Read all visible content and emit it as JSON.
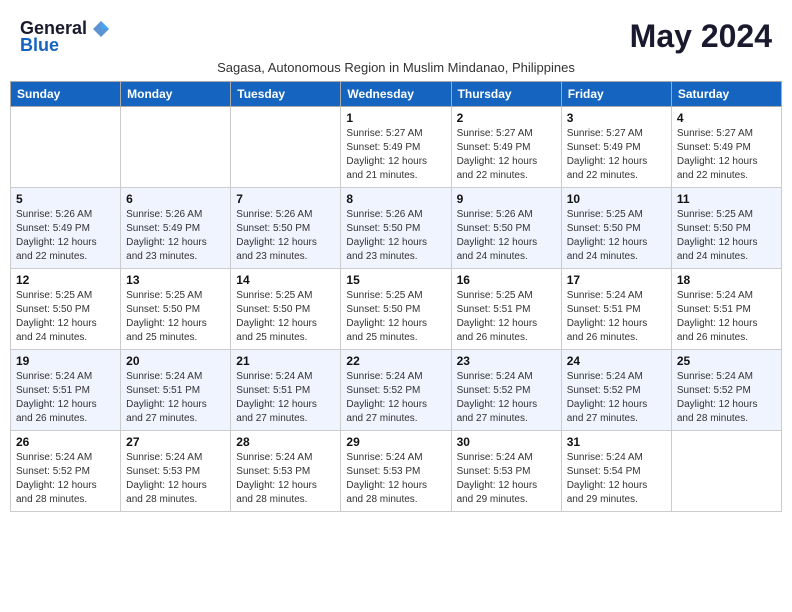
{
  "header": {
    "logo_general": "General",
    "logo_blue": "Blue",
    "month_title": "May 2024",
    "subtitle": "Sagasa, Autonomous Region in Muslim Mindanao, Philippines"
  },
  "weekdays": [
    "Sunday",
    "Monday",
    "Tuesday",
    "Wednesday",
    "Thursday",
    "Friday",
    "Saturday"
  ],
  "weeks": [
    [
      {
        "day": "",
        "info": ""
      },
      {
        "day": "",
        "info": ""
      },
      {
        "day": "",
        "info": ""
      },
      {
        "day": "1",
        "info": "Sunrise: 5:27 AM\nSunset: 5:49 PM\nDaylight: 12 hours\nand 21 minutes."
      },
      {
        "day": "2",
        "info": "Sunrise: 5:27 AM\nSunset: 5:49 PM\nDaylight: 12 hours\nand 22 minutes."
      },
      {
        "day": "3",
        "info": "Sunrise: 5:27 AM\nSunset: 5:49 PM\nDaylight: 12 hours\nand 22 minutes."
      },
      {
        "day": "4",
        "info": "Sunrise: 5:27 AM\nSunset: 5:49 PM\nDaylight: 12 hours\nand 22 minutes."
      }
    ],
    [
      {
        "day": "5",
        "info": "Sunrise: 5:26 AM\nSunset: 5:49 PM\nDaylight: 12 hours\nand 22 minutes."
      },
      {
        "day": "6",
        "info": "Sunrise: 5:26 AM\nSunset: 5:49 PM\nDaylight: 12 hours\nand 23 minutes."
      },
      {
        "day": "7",
        "info": "Sunrise: 5:26 AM\nSunset: 5:50 PM\nDaylight: 12 hours\nand 23 minutes."
      },
      {
        "day": "8",
        "info": "Sunrise: 5:26 AM\nSunset: 5:50 PM\nDaylight: 12 hours\nand 23 minutes."
      },
      {
        "day": "9",
        "info": "Sunrise: 5:26 AM\nSunset: 5:50 PM\nDaylight: 12 hours\nand 24 minutes."
      },
      {
        "day": "10",
        "info": "Sunrise: 5:25 AM\nSunset: 5:50 PM\nDaylight: 12 hours\nand 24 minutes."
      },
      {
        "day": "11",
        "info": "Sunrise: 5:25 AM\nSunset: 5:50 PM\nDaylight: 12 hours\nand 24 minutes."
      }
    ],
    [
      {
        "day": "12",
        "info": "Sunrise: 5:25 AM\nSunset: 5:50 PM\nDaylight: 12 hours\nand 24 minutes."
      },
      {
        "day": "13",
        "info": "Sunrise: 5:25 AM\nSunset: 5:50 PM\nDaylight: 12 hours\nand 25 minutes."
      },
      {
        "day": "14",
        "info": "Sunrise: 5:25 AM\nSunset: 5:50 PM\nDaylight: 12 hours\nand 25 minutes."
      },
      {
        "day": "15",
        "info": "Sunrise: 5:25 AM\nSunset: 5:50 PM\nDaylight: 12 hours\nand 25 minutes."
      },
      {
        "day": "16",
        "info": "Sunrise: 5:25 AM\nSunset: 5:51 PM\nDaylight: 12 hours\nand 26 minutes."
      },
      {
        "day": "17",
        "info": "Sunrise: 5:24 AM\nSunset: 5:51 PM\nDaylight: 12 hours\nand 26 minutes."
      },
      {
        "day": "18",
        "info": "Sunrise: 5:24 AM\nSunset: 5:51 PM\nDaylight: 12 hours\nand 26 minutes."
      }
    ],
    [
      {
        "day": "19",
        "info": "Sunrise: 5:24 AM\nSunset: 5:51 PM\nDaylight: 12 hours\nand 26 minutes."
      },
      {
        "day": "20",
        "info": "Sunrise: 5:24 AM\nSunset: 5:51 PM\nDaylight: 12 hours\nand 27 minutes."
      },
      {
        "day": "21",
        "info": "Sunrise: 5:24 AM\nSunset: 5:51 PM\nDaylight: 12 hours\nand 27 minutes."
      },
      {
        "day": "22",
        "info": "Sunrise: 5:24 AM\nSunset: 5:52 PM\nDaylight: 12 hours\nand 27 minutes."
      },
      {
        "day": "23",
        "info": "Sunrise: 5:24 AM\nSunset: 5:52 PM\nDaylight: 12 hours\nand 27 minutes."
      },
      {
        "day": "24",
        "info": "Sunrise: 5:24 AM\nSunset: 5:52 PM\nDaylight: 12 hours\nand 27 minutes."
      },
      {
        "day": "25",
        "info": "Sunrise: 5:24 AM\nSunset: 5:52 PM\nDaylight: 12 hours\nand 28 minutes."
      }
    ],
    [
      {
        "day": "26",
        "info": "Sunrise: 5:24 AM\nSunset: 5:52 PM\nDaylight: 12 hours\nand 28 minutes."
      },
      {
        "day": "27",
        "info": "Sunrise: 5:24 AM\nSunset: 5:53 PM\nDaylight: 12 hours\nand 28 minutes."
      },
      {
        "day": "28",
        "info": "Sunrise: 5:24 AM\nSunset: 5:53 PM\nDaylight: 12 hours\nand 28 minutes."
      },
      {
        "day": "29",
        "info": "Sunrise: 5:24 AM\nSunset: 5:53 PM\nDaylight: 12 hours\nand 28 minutes."
      },
      {
        "day": "30",
        "info": "Sunrise: 5:24 AM\nSunset: 5:53 PM\nDaylight: 12 hours\nand 29 minutes."
      },
      {
        "day": "31",
        "info": "Sunrise: 5:24 AM\nSunset: 5:54 PM\nDaylight: 12 hours\nand 29 minutes."
      },
      {
        "day": "",
        "info": ""
      }
    ]
  ]
}
